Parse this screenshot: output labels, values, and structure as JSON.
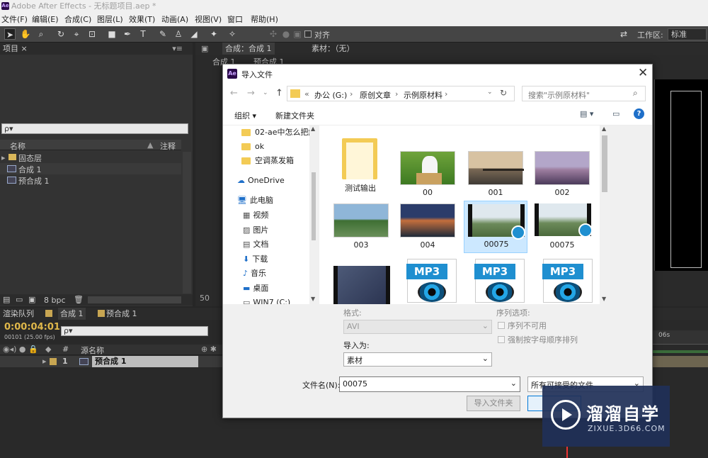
{
  "window": {
    "title": "Adobe After Effects - 无标题项目.aep *",
    "app_icon": "Ae"
  },
  "menu": [
    "文件(F)",
    "编辑(E)",
    "合成(C)",
    "图层(L)",
    "效果(T)",
    "动画(A)",
    "视图(V)",
    "窗口",
    "帮助(H)"
  ],
  "toolbar": {
    "align_label": "对齐",
    "workspace_label": "工作区:",
    "workspace_value": "标准"
  },
  "project_panel": {
    "tab": "项目 ×",
    "search_placeholder": "ρ▾",
    "col_name": "名称",
    "col_comment": "注释",
    "items": [
      "固态层",
      "合成 1",
      "预合成 1"
    ],
    "bpc": "8 bpc"
  },
  "comp_panel": {
    "tab": "合成：合成 1",
    "footage_label": "素材：（无）",
    "sub_tabs": [
      "合成 1",
      "预合成 1"
    ],
    "zoom": "50"
  },
  "timeline": {
    "tabs": [
      "渲染队列",
      "合成 1",
      "预合成 1"
    ],
    "timecode": "0:00:04:01",
    "frame_info": "00101 (25.00 fps)",
    "col_source": "源名称",
    "layer_index": "1",
    "layer_name": "预合成 1",
    "ruler_mark": "06s"
  },
  "dialog": {
    "title": "导入文件",
    "breadcrumb": [
      "«",
      "办公 (G:)",
      "原创文章",
      "示例原材料"
    ],
    "search_placeholder": "搜索\"示例原材料\"",
    "organize": "组织 ▾",
    "new_folder": "新建文件夹",
    "nav_items": [
      "02-ae中怎么把解",
      "ok",
      "空调蒸发箱",
      "OneDrive",
      "此电脑",
      "视频",
      "图片",
      "文档",
      "下载",
      "音乐",
      "桌面",
      "WIN7 (C:)"
    ],
    "files": [
      "测试输出",
      "00",
      "001",
      "002",
      "003",
      "004",
      "00075",
      "00075"
    ],
    "mp3_label": "MP3",
    "format_label": "格式:",
    "format_value": "AVI",
    "import_as_label": "导入为:",
    "import_as_value": "素材",
    "sequence_options_label": "序列选项:",
    "sequence_unavailable": "序列不可用",
    "force_alpha": "强制按字母顺序排列",
    "filename_label": "文件名(N):",
    "filename_value": "00075",
    "filter_value": "所有可接受的文件",
    "import_folder_button": "导入文件夹"
  },
  "watermark": {
    "brand": "溜溜自学",
    "url": "ZIXUE.3D66.COM"
  }
}
